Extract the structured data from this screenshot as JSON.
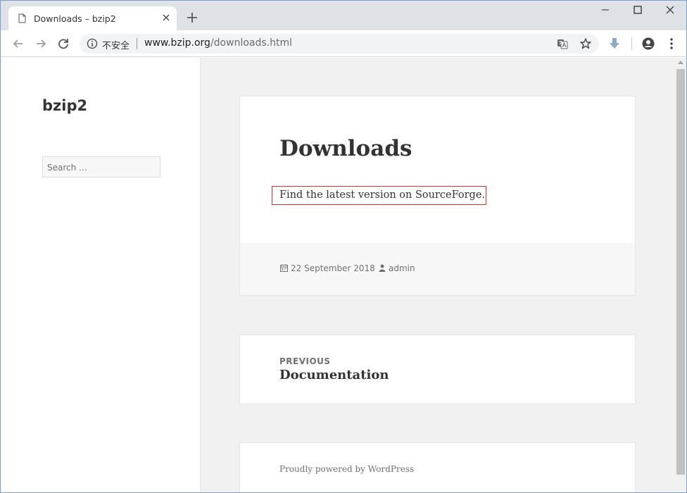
{
  "browser": {
    "tab_title": "Downloads – bzip2",
    "security_label": "不安全",
    "url_domain": "www.bzip.org",
    "url_path": "/downloads.html"
  },
  "sidebar": {
    "site_title": "bzip2",
    "search_placeholder": "Search …"
  },
  "post": {
    "title": "Downloads",
    "text": "Find the latest version on SourceForge.",
    "date": "22 September 2018",
    "author": "admin"
  },
  "post_navigation": {
    "label": "PREVIOUS",
    "title": "Documentation"
  },
  "footer": {
    "text": "Proudly powered by WordPress"
  },
  "icons": [
    "page-icon",
    "close-icon",
    "plus-icon",
    "minimize-icon",
    "maximize-icon",
    "window-close-icon",
    "back-arrow-icon",
    "forward-arrow-icon",
    "reload-icon",
    "info-icon",
    "translate-icon",
    "star-icon",
    "download-icon",
    "account-icon",
    "menu-dots-icon",
    "calendar-icon",
    "user-icon"
  ]
}
